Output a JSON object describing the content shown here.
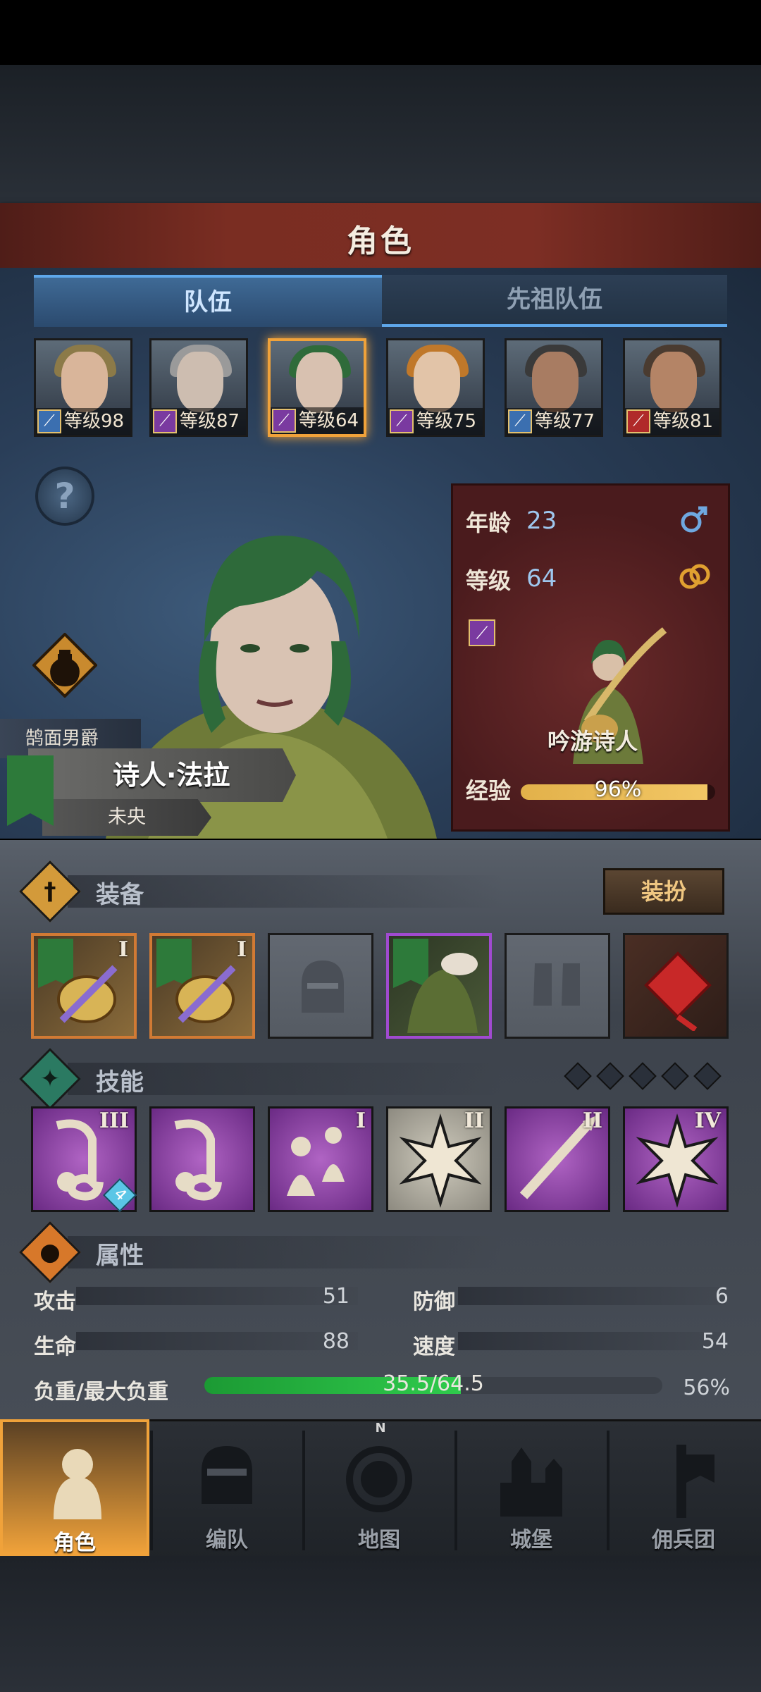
{
  "header": {
    "title": "角色"
  },
  "tabs": [
    {
      "label": "队伍",
      "active": true
    },
    {
      "label": "先祖队伍",
      "active": false
    }
  ],
  "party": [
    {
      "level_text": "等级98",
      "class_icon": "sword-icon",
      "class_color": "#3b6fb0",
      "hair": "#8c7a48",
      "skin": "#d9b59a",
      "selected": false
    },
    {
      "level_text": "等级87",
      "class_icon": "staff-icon",
      "class_color": "#7a3aa0",
      "hair": "#9a9a9a",
      "skin": "#cdbdb0",
      "selected": false
    },
    {
      "level_text": "等级64",
      "class_icon": "staff-icon",
      "class_color": "#7a3aa0",
      "hair": "#2f6b3a",
      "skin": "#d8c1b0",
      "selected": true
    },
    {
      "level_text": "等级75",
      "class_icon": "staff-icon",
      "class_color": "#7a3aa0",
      "hair": "#c0782a",
      "skin": "#e2c4a8",
      "selected": false
    },
    {
      "level_text": "等级77",
      "class_icon": "sword-icon",
      "class_color": "#3b6fb0",
      "hair": "#3a3a3a",
      "skin": "#a87c62",
      "selected": false
    },
    {
      "level_text": "等级81",
      "class_icon": "horse-icon",
      "class_color": "#b02a2a",
      "hair": "#4a3b30",
      "skin": "#b48466",
      "selected": false
    }
  ],
  "hero": {
    "epithet": "鹄面男爵",
    "name": "诗人·法拉",
    "subtitle": "未央"
  },
  "info": {
    "age_label": "年龄",
    "age": "23",
    "gender_icon": "male-icon",
    "level_label": "等级",
    "level": "64",
    "marriage_icon": "ring-icon",
    "class_name": "吟游诗人",
    "exp_label": "经验",
    "exp_pct_text": "96%",
    "exp_fraction": 0.96
  },
  "equipment": {
    "label": "装备",
    "dress_button": "装扮",
    "slots": [
      {
        "type": "weapon",
        "rank": "I",
        "quality": "orange"
      },
      {
        "type": "weapon",
        "rank": "I",
        "quality": "orange"
      },
      {
        "type": "helmet",
        "rank": "",
        "quality": "empty"
      },
      {
        "type": "armor",
        "rank": "",
        "quality": "purple"
      },
      {
        "type": "boots",
        "rank": "",
        "quality": "empty"
      },
      {
        "type": "trinket",
        "rank": "",
        "quality": "red"
      }
    ]
  },
  "skills": {
    "label": "技能",
    "pip_count": 5,
    "items": [
      {
        "rank": "III",
        "style": "purple",
        "badge": "4"
      },
      {
        "rank": "",
        "style": "purple",
        "badge": ""
      },
      {
        "rank": "I",
        "style": "purple",
        "badge": ""
      },
      {
        "rank": "II",
        "style": "grey",
        "badge": ""
      },
      {
        "rank": "II",
        "style": "purple",
        "badge": ""
      },
      {
        "rank": "IV",
        "style": "purple",
        "badge": ""
      }
    ]
  },
  "attributes": {
    "label": "属性",
    "attack_label": "攻击",
    "attack": "51",
    "defense_label": "防御",
    "defense": "6",
    "hp_label": "生命",
    "hp": "88",
    "speed_label": "速度",
    "speed": "54",
    "load_label": "负重/最大负重",
    "load_text": "35.5/64.5",
    "load_pct_text": "56%",
    "load_fraction": 0.56
  },
  "nav": [
    {
      "label": "角色",
      "icon": "knight-icon",
      "active": true
    },
    {
      "label": "编队",
      "icon": "helmet-icon",
      "active": false
    },
    {
      "label": "地图",
      "icon": "compass-icon",
      "active": false
    },
    {
      "label": "城堡",
      "icon": "castle-icon",
      "active": false
    },
    {
      "label": "佣兵团",
      "icon": "banner-icon",
      "active": false
    }
  ],
  "compass_north": "N",
  "colors": {
    "accent": "#f0a23a",
    "tab_active": "#5ea7ea",
    "panel_red": "#7a2d22",
    "exp_bar": "#e2b14a",
    "load_bar": "#2fcb4c"
  }
}
